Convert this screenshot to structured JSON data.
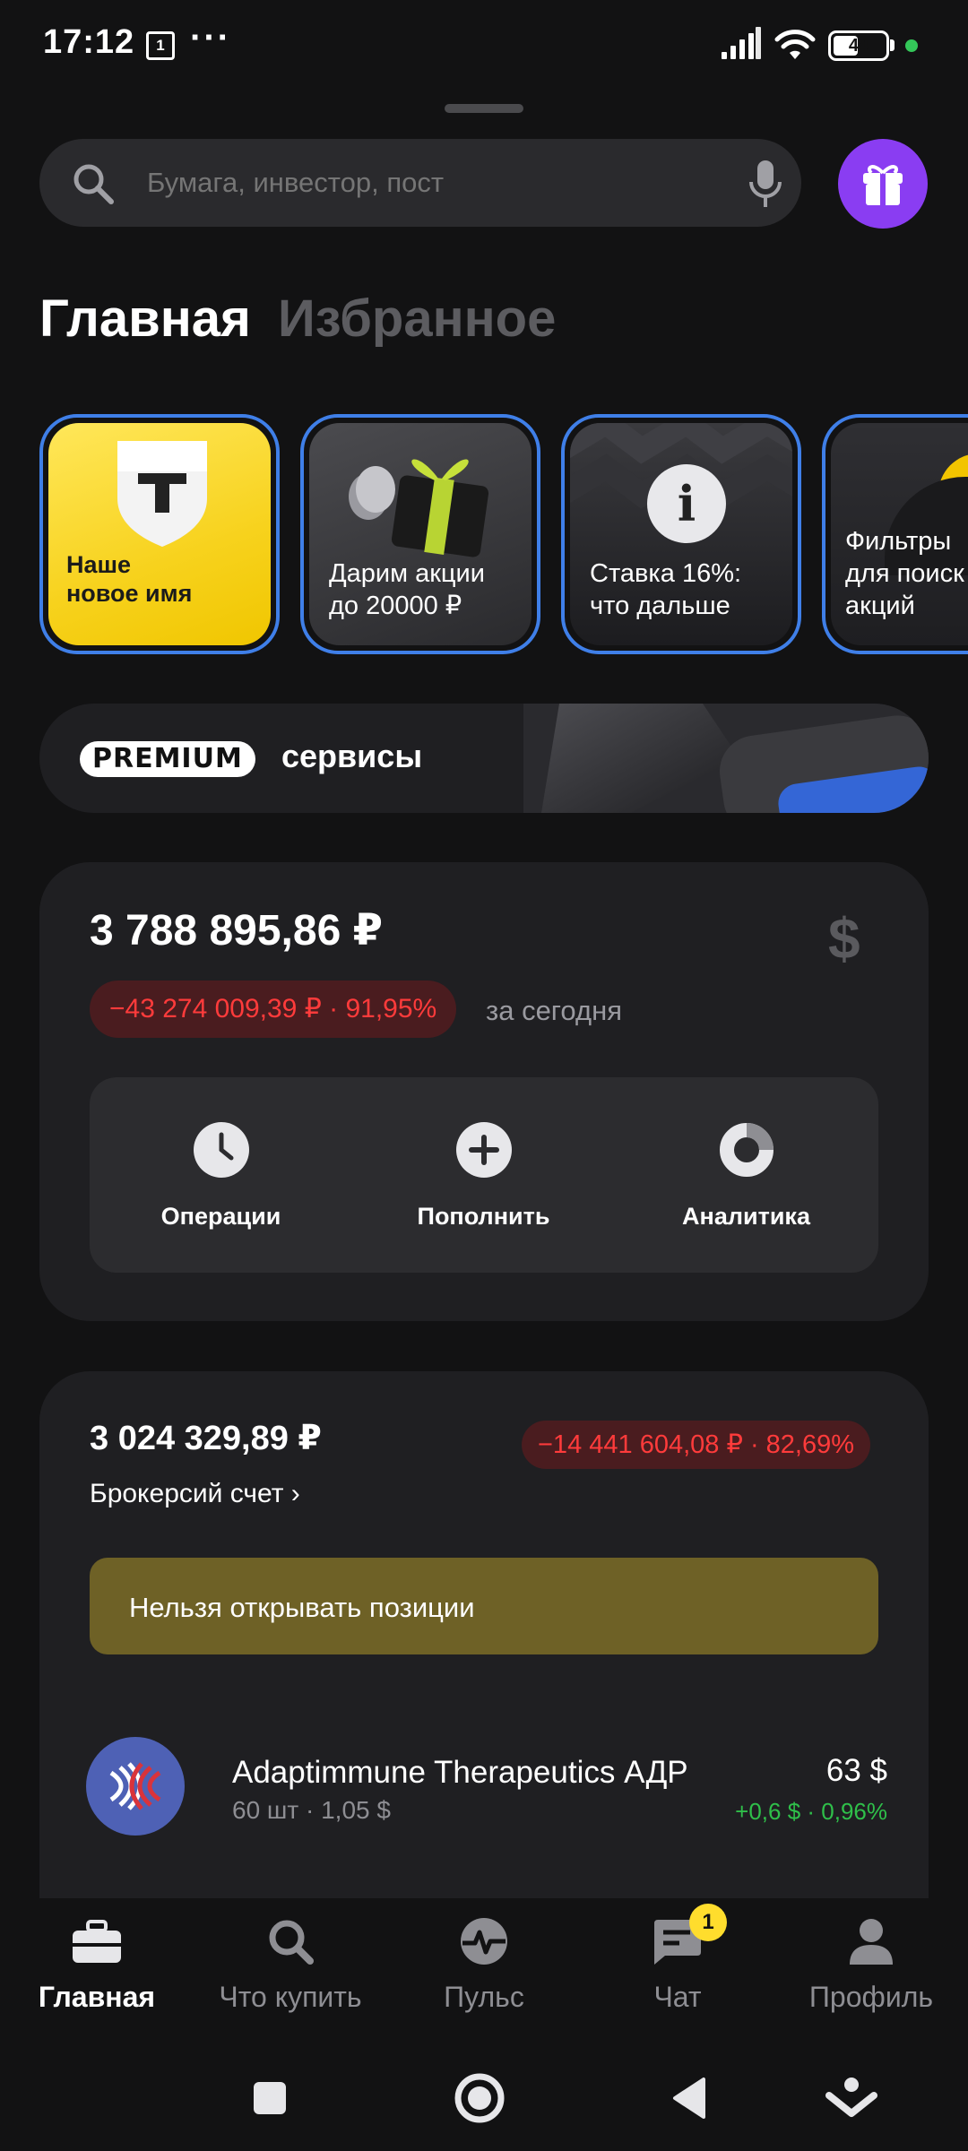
{
  "status_bar": {
    "time": "17:12",
    "calendar_day": "1",
    "more": "···",
    "battery": "44"
  },
  "search": {
    "placeholder": "Бумага, инвестор, пост"
  },
  "tabs": [
    {
      "label": "Главная",
      "active": true
    },
    {
      "label": "Избранное",
      "active": false
    }
  ],
  "stories": [
    {
      "text": "Наше\nновое имя",
      "logo_letter": "T"
    },
    {
      "text": "Дарим акции\nдо 20000 ₽"
    },
    {
      "text": "Ставка 16%:\nчто дальше",
      "icon_letter": "i"
    },
    {
      "text": "Фильтры\nдля поиск\nакций"
    }
  ],
  "premium": {
    "badge": "PREMIUM",
    "label": "сервисы"
  },
  "portfolio": {
    "total": "3 788 895,86 ₽",
    "currency_symbol": "$",
    "change": "−43 274 009,39 ₽ · 91,95%",
    "period": "за сегодня",
    "actions": [
      {
        "label": "Операции",
        "icon": "clock-icon"
      },
      {
        "label": "Пополнить",
        "icon": "plus-icon"
      },
      {
        "label": "Аналитика",
        "icon": "donut-chart-icon"
      }
    ]
  },
  "broker": {
    "total": "3 024 329,89 ₽",
    "change": "−14 441 604,08 ₽ · 82,69%",
    "account_name": "Брокерсий счет ›",
    "warning": "Нельзя открывать позиции",
    "position": {
      "name": "Adaptimmune Therapeutics АДР",
      "quantity": "60 шт · 1,05 $",
      "value": "63 $",
      "change": "+0,6 $ · 0,96%"
    }
  },
  "bottom_nav": [
    {
      "label": "Главная",
      "icon": "briefcase-icon",
      "active": true
    },
    {
      "label": "Что купить",
      "icon": "search-icon",
      "active": false
    },
    {
      "label": "Пульс",
      "icon": "pulse-icon",
      "active": false
    },
    {
      "label": "Чат",
      "icon": "chat-icon",
      "active": false,
      "badge": "1"
    },
    {
      "label": "Профиль",
      "icon": "profile-icon",
      "active": false
    }
  ],
  "colors": {
    "background": "#121213",
    "card": "#1f1f22",
    "accent_purple": "#8a3df2",
    "negative": "#ff3b3b",
    "positive": "#2fbf4a",
    "warning": "#6e6126",
    "story_border": "#3f7fe8"
  }
}
